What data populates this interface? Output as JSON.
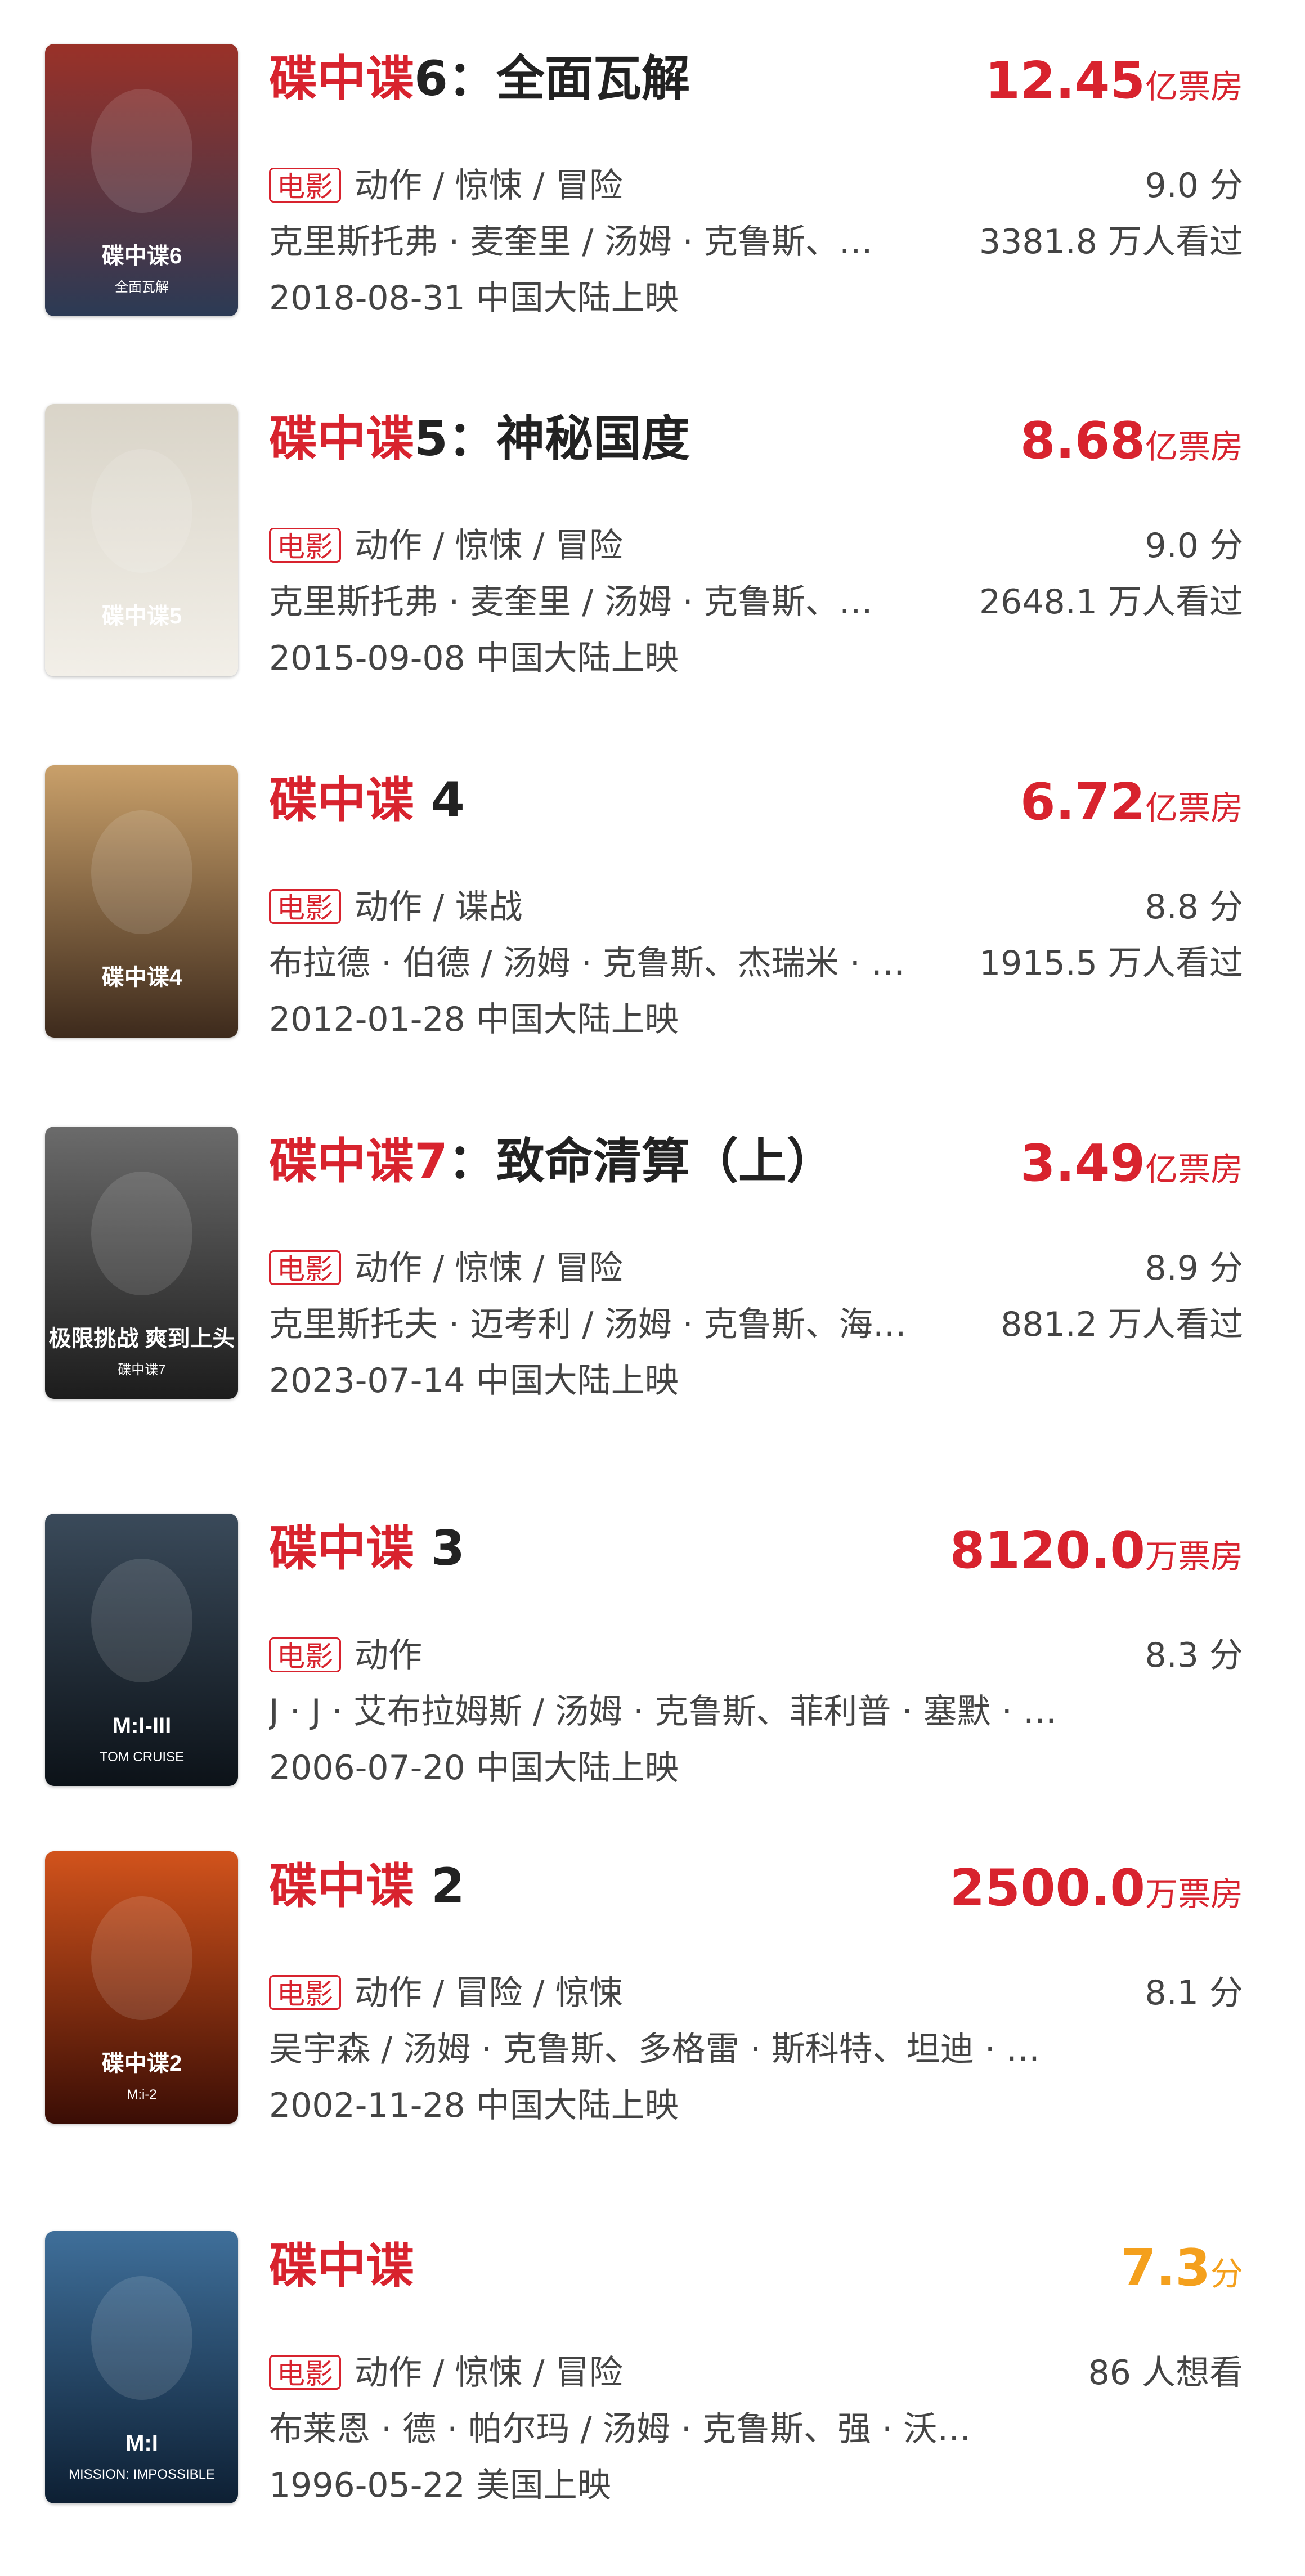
{
  "movies": [
    {
      "title_red": "碟中谍",
      "title_rest": "6：全面瓦解",
      "box_num": "12.45",
      "box_unit": "亿票房",
      "tag": "电影",
      "genres": "动作 / 惊悚 / 冒险",
      "rating": "9.0 分",
      "cast": "克里斯托弗 · 麦奎里 / 汤姆 · 克鲁斯、…",
      "viewers": "3381.8 万人看过",
      "release": "2018-08-31 中国大陆上映",
      "poster": {
        "text": "碟中谍6",
        "subtext": "全面瓦解",
        "colors": [
          "#9a3128",
          "#2b3a55"
        ]
      }
    },
    {
      "title_red": "碟中谍",
      "title_rest": "5：神秘国度",
      "box_num": "8.68",
      "box_unit": "亿票房",
      "tag": "电影",
      "genres": "动作 / 惊悚 / 冒险",
      "rating": "9.0 分",
      "cast": "克里斯托弗 · 麦奎里 / 汤姆 · 克鲁斯、…",
      "viewers": "2648.1 万人看过",
      "release": "2015-09-08 中国大陆上映",
      "poster": {
        "text": "碟中谍5",
        "subtext": "",
        "colors": [
          "#d9d4c8",
          "#f2efe8"
        ]
      }
    },
    {
      "title_red": "碟中谍",
      "title_rest": " 4",
      "box_num": "6.72",
      "box_unit": "亿票房",
      "tag": "电影",
      "genres": "动作 / 谍战",
      "rating": "8.8 分",
      "cast": "布拉德 · 伯德 / 汤姆 · 克鲁斯、杰瑞米 · …",
      "viewers": "1915.5 万人看过",
      "release": "2012-01-28 中国大陆上映",
      "poster": {
        "text": "碟中谍4",
        "subtext": "",
        "colors": [
          "#c9a06a",
          "#3d2a1c"
        ]
      }
    },
    {
      "title_red": "碟中谍7",
      "title_rest": "：致命清算（上）",
      "box_num": "3.49",
      "box_unit": "亿票房",
      "tag": "电影",
      "genres": "动作 / 惊悚 / 冒险",
      "rating": "8.9 分",
      "cast": "克里斯托夫 · 迈考利 / 汤姆 · 克鲁斯、海…",
      "viewers": "881.2 万人看过",
      "release": "2023-07-14 中国大陆上映",
      "poster": {
        "text": "极限挑战 爽到上头",
        "subtext": "碟中谍7",
        "colors": [
          "#6b6b6b",
          "#1c1c1c"
        ]
      }
    },
    {
      "title_red": "碟中谍",
      "title_rest": " 3",
      "box_num": "8120.0",
      "box_unit": "万票房",
      "tag": "电影",
      "genres": "动作",
      "rating": "8.3 分",
      "cast": "J · J · 艾布拉姆斯 / 汤姆 · 克鲁斯、菲利普 · 塞默 · …",
      "viewers": "",
      "release": "2006-07-20 中国大陆上映",
      "poster": {
        "text": "M:I-III",
        "subtext": "TOM CRUISE",
        "colors": [
          "#3a4a5a",
          "#0c1218"
        ]
      }
    },
    {
      "title_red": "碟中谍",
      "title_rest": " 2",
      "box_num": "2500.0",
      "box_unit": "万票房",
      "tag": "电影",
      "genres": "动作 / 冒险 / 惊悚",
      "rating": "8.1 分",
      "cast": "吴宇森 / 汤姆 · 克鲁斯、多格雷 · 斯科特、坦迪 · …",
      "viewers": "",
      "release": "2002-11-28 中国大陆上映",
      "poster": {
        "text": "碟中谍2",
        "subtext": "M:i-2",
        "colors": [
          "#d2531c",
          "#3a0d05"
        ]
      }
    },
    {
      "title_red": "碟中谍",
      "title_rest": "",
      "box_num": "7.3",
      "box_unit": "分",
      "box_is_score": true,
      "tag": "电影",
      "genres": "动作 / 惊悚 / 冒险",
      "rating": "86 人想看",
      "cast": "布莱恩 · 德 · 帕尔玛 / 汤姆 · 克鲁斯、强 · 沃…",
      "viewers": "",
      "release": "1996-05-22 美国上映",
      "poster": {
        "text": "M:I",
        "subtext": "MISSION: IMPOSSIBLE",
        "colors": [
          "#3f6f9a",
          "#0d1f33"
        ]
      }
    }
  ]
}
